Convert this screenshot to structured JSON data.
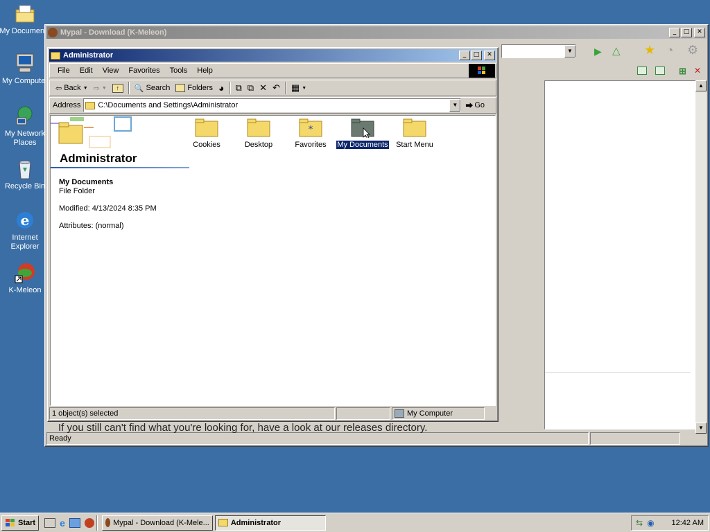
{
  "desktop": {
    "icons": [
      {
        "label": "My Documents"
      },
      {
        "label": "My Computer"
      },
      {
        "label": "My Network Places"
      },
      {
        "label": "Recycle Bin"
      },
      {
        "label": "Internet Explorer"
      },
      {
        "label": "K-Meleon"
      }
    ]
  },
  "mypal": {
    "title": "Mypal - Download (K-Meleon)",
    "body_text": "If you still can't find what you're looking for, have a look at our releases directory.",
    "status_text": "Ready"
  },
  "explorer": {
    "title": "Administrator",
    "menu": [
      "File",
      "Edit",
      "View",
      "Favorites",
      "Tools",
      "Help"
    ],
    "toolbar": {
      "back": "Back",
      "search": "Search",
      "folders": "Folders"
    },
    "address_label": "Address",
    "address_value": "C:\\Documents and Settings\\Administrator",
    "go_label": "Go",
    "webview": {
      "heading": "Administrator",
      "selected_name": "My Documents",
      "selected_type": "File Folder",
      "modified": "Modified: 4/13/2024 8:35 PM",
      "attributes": "Attributes: (normal)"
    },
    "folders": [
      {
        "label": "Cookies"
      },
      {
        "label": "Desktop"
      },
      {
        "label": "Favorites"
      },
      {
        "label": "My Documents"
      },
      {
        "label": "Start Menu"
      }
    ],
    "status": {
      "selection": "1 object(s) selected",
      "zone": "My Computer"
    }
  },
  "taskbar": {
    "start_label": "Start",
    "tasks": [
      {
        "label": "Mypal - Download (K-Mele..."
      },
      {
        "label": "Administrator"
      }
    ],
    "clock": "12:42 AM"
  }
}
